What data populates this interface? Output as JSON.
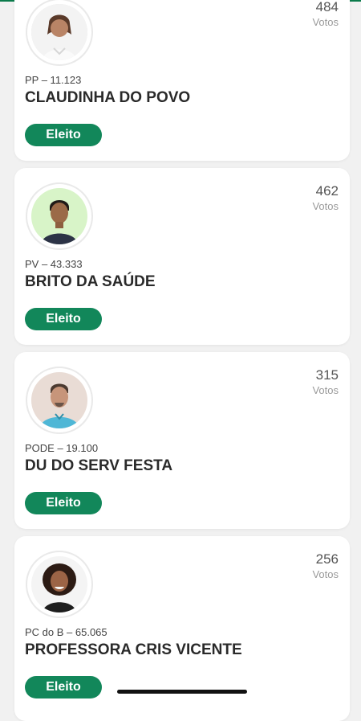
{
  "colors": {
    "accent": "#12875a",
    "background": "#f1f1f1",
    "card": "#ffffff"
  },
  "candidates": [
    {
      "votes": "484",
      "votes_label": "Votos",
      "party": "PP – 11.123",
      "name": "CLAUDINHA DO POVO",
      "status": "Eleito",
      "avatar": "candidate-photo-woman"
    },
    {
      "votes": "462",
      "votes_label": "Votos",
      "party": "PV – 43.333",
      "name": "BRITO DA SAÚDE",
      "status": "Eleito",
      "avatar": "candidate-photo-man"
    },
    {
      "votes": "315",
      "votes_label": "Votos",
      "party": "PODE – 19.100",
      "name": "DU DO SERV FESTA",
      "status": "Eleito",
      "avatar": "candidate-photo-man"
    },
    {
      "votes": "256",
      "votes_label": "Votos",
      "party": "PC do B – 65.065",
      "name": "PROFESSORA CRIS VICENTE",
      "status": "Eleito",
      "avatar": "candidate-photo-woman"
    }
  ]
}
